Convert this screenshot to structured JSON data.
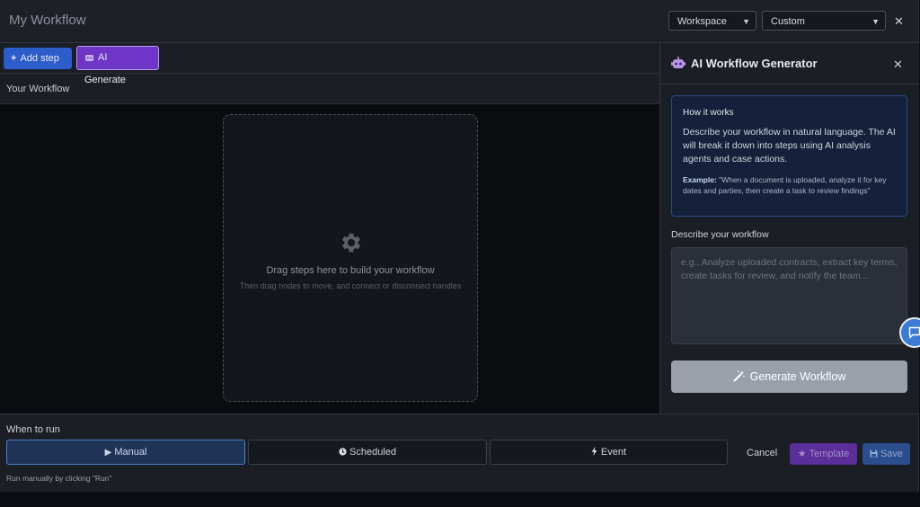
{
  "header": {
    "title": "My Workflow",
    "workspace_select": "Workspace",
    "custom_select": "Custom"
  },
  "toolbar": {
    "add_step": "Add step",
    "ai_generate": "AI Generate"
  },
  "canvas": {
    "section_label": "Your Workflow",
    "drop_title": "Drag steps here to build your workflow",
    "drop_hint": "Then drag nodes to move, and connect or disconnect handles"
  },
  "panel": {
    "title": "AI Workflow Generator",
    "info_heading": "How it works",
    "info_text": "Describe your workflow in natural language. The AI will break it down into steps using AI analysis agents and case actions.",
    "example_label": "Example:",
    "example_text": "\"When a document is uploaded, analyze it for key dates and parties, then create a task to review findings\"",
    "describe_label": "Describe your workflow",
    "describe_placeholder": "e.g., Analyze uploaded contracts, extract key terms, create tasks for review, and notify the team...",
    "generate_button": "Generate Workflow"
  },
  "footer": {
    "when_label": "When to run",
    "triggers": [
      {
        "label": "Manual",
        "active": true
      },
      {
        "label": "Scheduled",
        "active": false
      },
      {
        "label": "Event",
        "active": false
      }
    ],
    "hint": "Run manually by clicking \"Run\"",
    "cancel": "Cancel",
    "template": "Template",
    "save": "Save"
  },
  "colors": {
    "accent_blue": "#2c5dcb",
    "accent_purple": "#6f35c6",
    "info_bg": "#15213b"
  }
}
